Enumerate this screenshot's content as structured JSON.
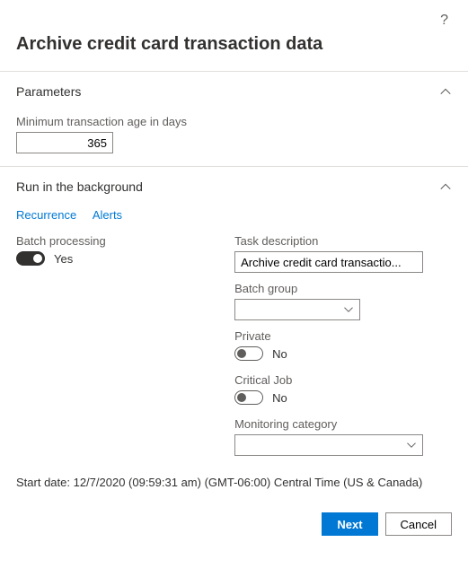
{
  "header": {
    "title": "Archive credit card transaction data"
  },
  "sections": {
    "parameters": {
      "title": "Parameters",
      "min_age_label": "Minimum transaction age in days",
      "min_age_value": "365"
    },
    "background": {
      "title": "Run in the background",
      "tabs": {
        "recurrence": "Recurrence",
        "alerts": "Alerts"
      },
      "batch_processing_label": "Batch processing",
      "batch_processing_value": "Yes",
      "task_description_label": "Task description",
      "task_description_value": "Archive credit card transactio...",
      "batch_group_label": "Batch group",
      "batch_group_value": "",
      "private_label": "Private",
      "private_value": "No",
      "critical_job_label": "Critical Job",
      "critical_job_value": "No",
      "monitoring_category_label": "Monitoring category",
      "monitoring_category_value": ""
    }
  },
  "start_date": "Start date: 12/7/2020 (09:59:31 am) (GMT-06:00) Central Time (US & Canada)",
  "footer": {
    "next": "Next",
    "cancel": "Cancel"
  }
}
